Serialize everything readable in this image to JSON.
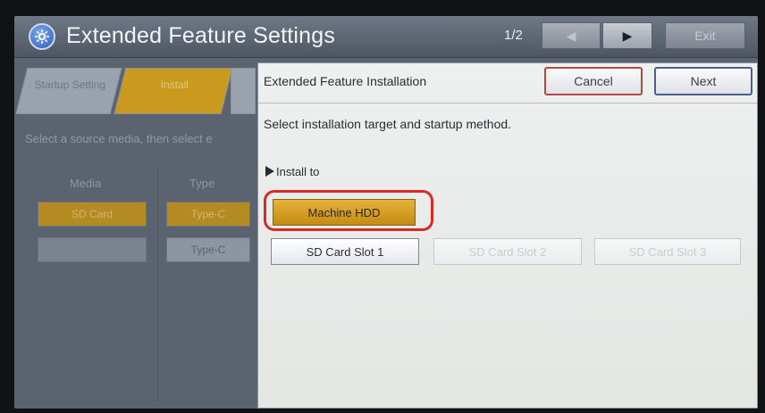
{
  "header": {
    "title": "Extended Feature Settings",
    "page_indicator": "1/2",
    "exit_label": "Exit",
    "icon": "app-gear-icon"
  },
  "background_panel": {
    "tabs": [
      {
        "label": "Startup Setting"
      },
      {
        "label": "Install"
      }
    ],
    "instruction": "Select a source media, then select e",
    "columns": {
      "media": "Media",
      "type": "Type"
    },
    "media_rows": [
      "SD Card",
      ""
    ],
    "type_rows": [
      "Type-C",
      "Type-C"
    ]
  },
  "dialog": {
    "title": "Extended Feature Installation",
    "cancel_label": "Cancel",
    "next_label": "Next",
    "instruction": "Select installation target and startup method.",
    "install_to_label": "Install to",
    "targets": [
      {
        "label": "Machine HDD",
        "state": "selected"
      },
      {
        "label": "SD Card Slot 1",
        "state": "enabled"
      },
      {
        "label": "SD Card Slot 2",
        "state": "disabled"
      },
      {
        "label": "SD Card Slot 3",
        "state": "disabled"
      }
    ]
  },
  "colors": {
    "selected": "#d9a22a",
    "highlight_ring": "#d72a24",
    "cancel_border": "#b04a44",
    "next_border": "#4a5f8a"
  }
}
